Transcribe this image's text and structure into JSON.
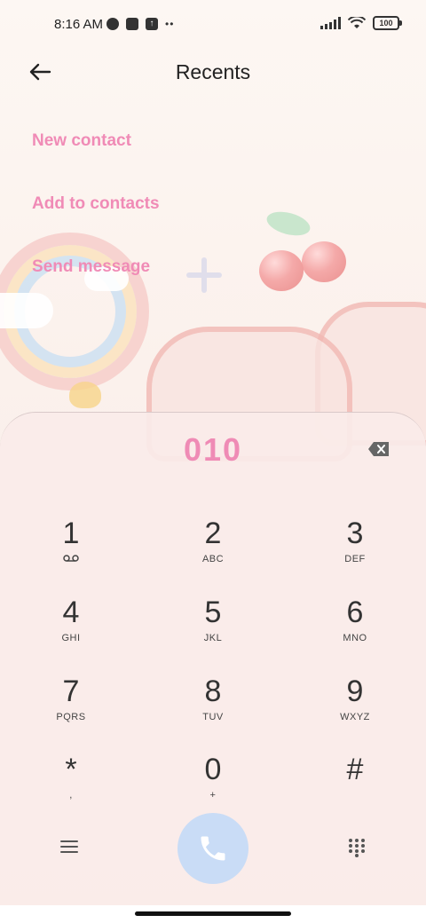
{
  "status_bar": {
    "time": "8:16 AM",
    "battery": "100"
  },
  "header": {
    "title": "Recents"
  },
  "actions": [
    {
      "label": "New contact"
    },
    {
      "label": "Add to contacts"
    },
    {
      "label": "Send message"
    }
  ],
  "dialer": {
    "number": "010",
    "keys": [
      {
        "digit": "1",
        "sub": ""
      },
      {
        "digit": "2",
        "sub": "ABC"
      },
      {
        "digit": "3",
        "sub": "DEF"
      },
      {
        "digit": "4",
        "sub": "GHI"
      },
      {
        "digit": "5",
        "sub": "JKL"
      },
      {
        "digit": "6",
        "sub": "MNO"
      },
      {
        "digit": "7",
        "sub": "PQRS"
      },
      {
        "digit": "8",
        "sub": "TUV"
      },
      {
        "digit": "9",
        "sub": "WXYZ"
      },
      {
        "digit": "*",
        "sub": ","
      },
      {
        "digit": "0",
        "sub": "+"
      },
      {
        "digit": "#",
        "sub": ""
      }
    ]
  },
  "colors": {
    "accent_pink": "#ef8bb5",
    "call_button": "#c9dcf6"
  },
  "icons": {
    "back": "arrow-left-icon",
    "backspace": "backspace-icon",
    "voicemail": "voicemail-icon",
    "menu": "menu-icon",
    "call": "phone-icon",
    "keypad": "dialpad-icon"
  }
}
